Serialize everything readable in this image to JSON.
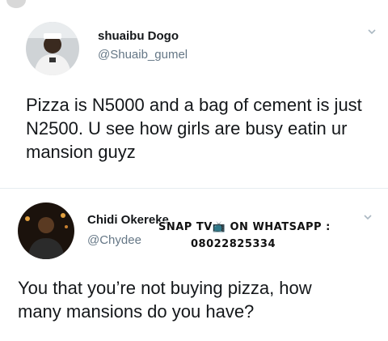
{
  "tweets": [
    {
      "name": "shuaibu Dogo",
      "handle": "@Shuaib_gumel",
      "text": "Pizza is N5000 and a bag of cement is just N2500.  U see how girls are busy eatin ur mansion guyz",
      "avatar_icon": "profile-photo"
    },
    {
      "name": "Chidi Okereke",
      "handle": "@Chydee",
      "text": "You that you’re not buying pizza, how many mansions do you have?",
      "avatar_icon": "profile-photo"
    }
  ],
  "watermark": {
    "line1": "SNAP TV📺 ON WHATSAPP :",
    "line2": "08022825334"
  },
  "colors": {
    "text": "#14171a",
    "secondary": "#657786",
    "chevron": "#aab8c2",
    "divider": "#e6ecf0"
  }
}
